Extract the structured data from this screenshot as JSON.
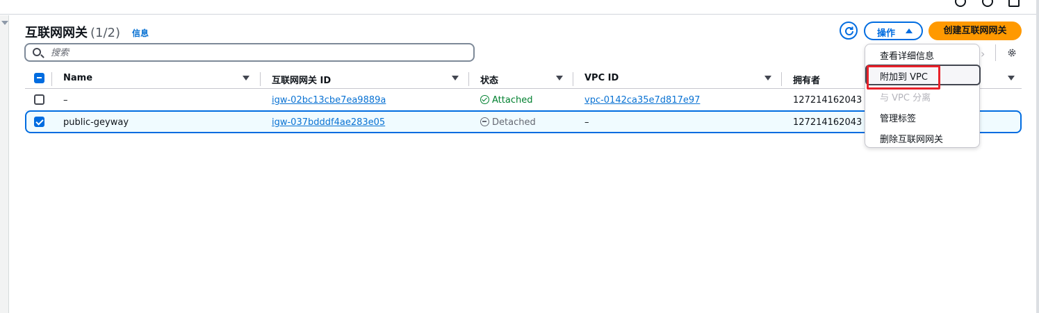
{
  "page": {
    "title": "互联网网关",
    "count": "(1/2)",
    "info_link": "信息"
  },
  "toolbar": {
    "search_placeholder": "搜索",
    "actions_label": "操作",
    "create_label": "创建互联网网关",
    "pager_next": "›"
  },
  "table": {
    "columns": [
      "Name",
      "互联网网关 ID",
      "状态",
      "VPC ID",
      "拥有者"
    ],
    "rows": [
      {
        "name": "–",
        "igw_id": "igw-02bc13cbe7ea9889a",
        "state": "Attached",
        "vpc_id": "vpc-0142ca35e7d817e97",
        "owner": "127214162043",
        "selected": false
      },
      {
        "name": "public-geyway",
        "igw_id": "igw-037bdddf4ae283e05",
        "state": "Detached",
        "vpc_id": "–",
        "owner": "127214162043",
        "selected": true
      }
    ]
  },
  "actions_menu": {
    "items": [
      {
        "label": "查看详细信息",
        "disabled": false
      },
      {
        "label": "附加到 VPC",
        "disabled": false,
        "highlighted": true
      },
      {
        "label": "与 VPC 分离",
        "disabled": true
      },
      {
        "label": "管理标签",
        "disabled": false
      },
      {
        "label": "删除互联网网关",
        "disabled": false
      }
    ]
  },
  "colors": {
    "primary": "#006ce0",
    "link": "#0972d3",
    "create_button": "#ff9900",
    "attached": "#00802f",
    "detached": "#656871",
    "annotation_box": "#e8212a"
  }
}
